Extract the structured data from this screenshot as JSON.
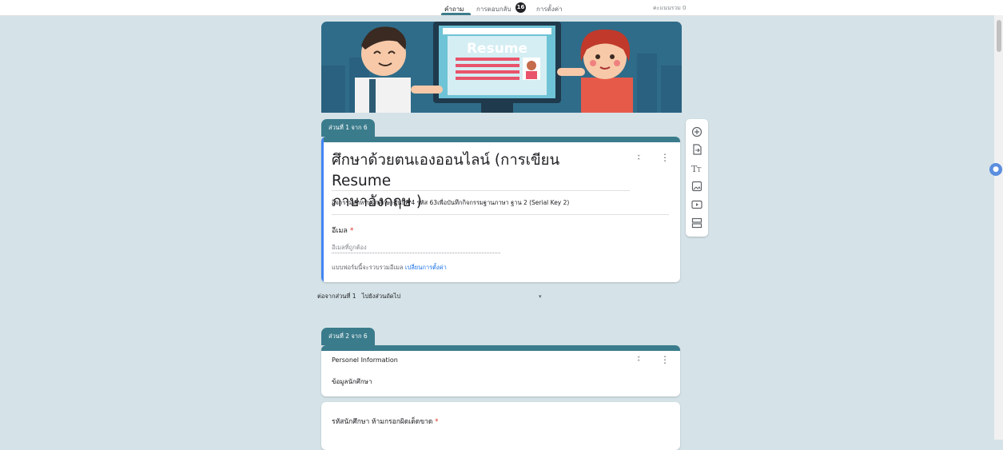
{
  "tabs": [
    {
      "label": "คำถาม",
      "active": true
    },
    {
      "label": "การตอบกลับ",
      "badge": "16"
    },
    {
      "label": "การตั้งค่า"
    }
  ],
  "points": "คะแนนรวม 0",
  "banner": {
    "word": "Resume"
  },
  "section1": {
    "tab": "ส่วนที่ 1 จาก 6",
    "title_line1": "ศึกษาด้วยตนเองออนไลน์ (การเขียน Resume",
    "title_line2": "ภาษาอังกฤษ )",
    "description": "กิจกรรมสำหรับนักศึกษาชั้นปีที่ 4 รหัส 63เพื่อบันทึกกิจกรรมฐานภาษา ฐาน 2 (Serial Key 2)",
    "email_label": "อีเมล",
    "email_required": "*",
    "email_placeholder": "อีเมลที่ถูกต้อง",
    "collect_note": "แบบฟอร์มนี้จะรวบรวมอีเมล",
    "change_settings": "เปลี่ยนการตั้งค่า"
  },
  "after_section": {
    "label": "ต่อจากส่วนที่ 1",
    "value": "ไปยังส่วนถัดไป"
  },
  "section2": {
    "tab": "ส่วนที่ 2 จาก 6",
    "title": "Personel Information",
    "description": "ข้อมูลนักศึกษา"
  },
  "question": {
    "label": "รหัสนักศึกษา ห้ามกรอกผิดเด็ดขาด",
    "required": "*"
  },
  "colors": {
    "accent": "#3b7c8c",
    "background": "#d5e3e8",
    "link": "#1a73e8"
  },
  "toolbar_icons": [
    "add-question-icon",
    "import-questions-icon",
    "add-title-icon",
    "add-image-icon",
    "add-video-icon",
    "add-section-icon"
  ]
}
